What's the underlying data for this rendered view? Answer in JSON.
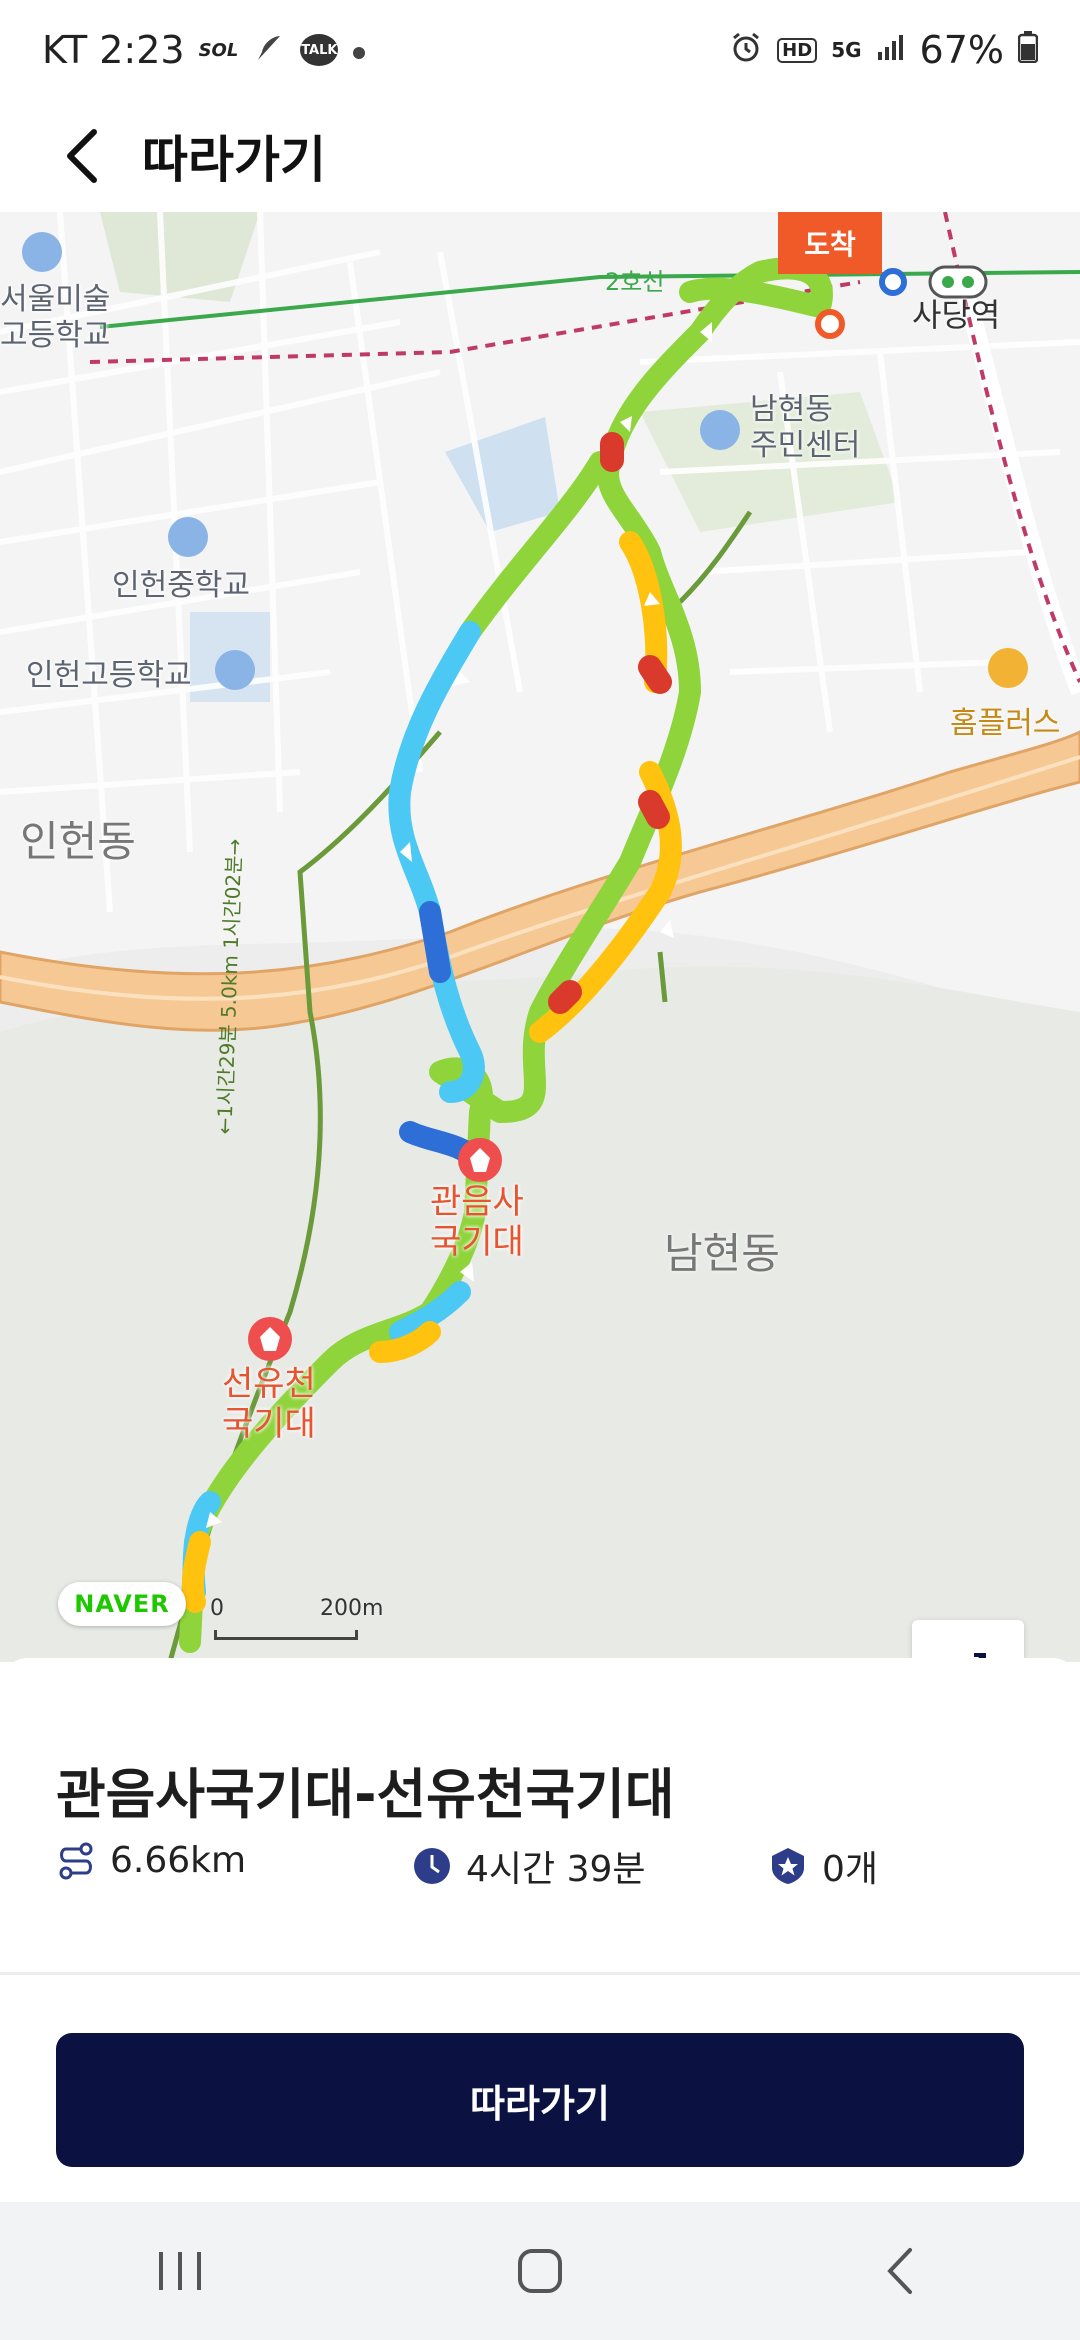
{
  "status_bar": {
    "carrier_time": "KT 2:23",
    "notifications": [
      "sol-bank-icon",
      "feather-icon",
      "talk-icon",
      "dot"
    ],
    "talk_label": "TALK",
    "bank_label": "SOL",
    "hd_label": "HD",
    "network": "5G",
    "battery": "67%"
  },
  "header": {
    "title": "따라가기"
  },
  "map": {
    "arrival_label": "도착",
    "labels": {
      "school_art": "서울미술\n고등학교",
      "line2": "2호선",
      "sadang": "사당역",
      "namhyeon_center": "남현동\n주민센터",
      "inheon_middle": "인헌중학교",
      "inheon_high": "인헌고등학교",
      "inheon_dong": "인헌동",
      "homeplus": "홈플러스",
      "gwaneumsa": "관음사\n국기대",
      "seonyucheon": "선유천\n국기대",
      "namhyeon_dong": "남현동",
      "trail_note": "←1시간29분 5.0km 1시간02분→"
    },
    "naver": "NAVER",
    "scale_zero": "0",
    "scale_label": "200m",
    "tools": [
      "elevation-profile-icon",
      "reverse-direction-icon"
    ]
  },
  "course": {
    "title": "관음사국기대-선유천국기대",
    "distance": "6.66km",
    "duration": "4시간 39분",
    "badges": "0개"
  },
  "action": {
    "follow_label": "따라가기"
  },
  "nav_bar": {
    "items": [
      "recent-apps",
      "home",
      "back"
    ]
  },
  "colors": {
    "primary": "#0b1140",
    "arrival": "#f05a28",
    "route_green": "#8ed43a",
    "route_cyan": "#4cc8f4",
    "route_blue": "#2d6fd6",
    "route_yellow": "#ffc20e",
    "route_red": "#d93a2b"
  }
}
